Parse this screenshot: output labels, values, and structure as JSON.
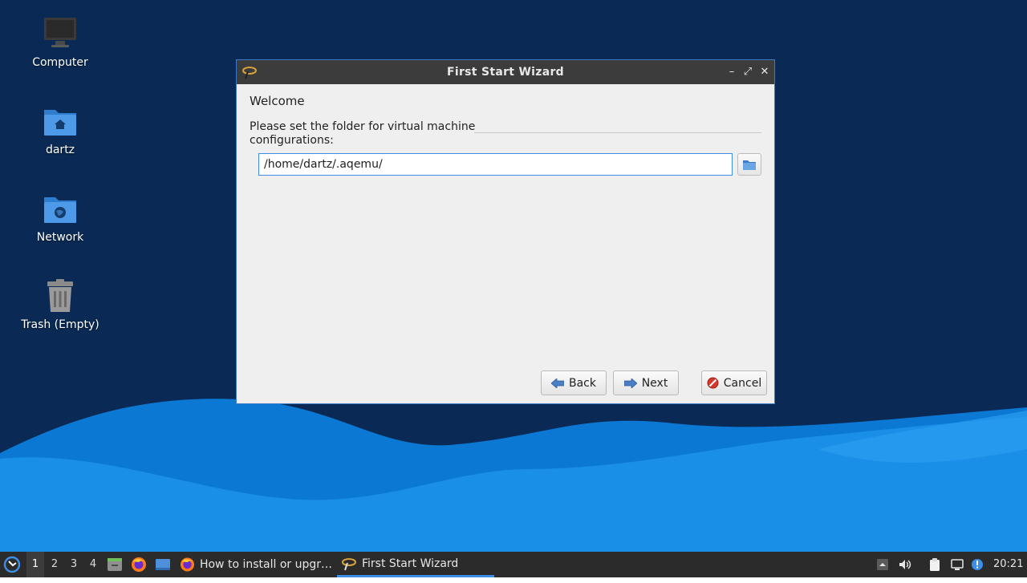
{
  "desktop": {
    "icons": [
      {
        "label": "Computer",
        "icon": "computer-icon"
      },
      {
        "label": "dartz",
        "icon": "home-folder-icon"
      },
      {
        "label": "Network",
        "icon": "network-folder-icon"
      },
      {
        "label": "Trash (Empty)",
        "icon": "trash-icon"
      }
    ]
  },
  "window": {
    "title": "First Start Wizard",
    "heading": "Welcome",
    "prompt": "Please set the folder for virtual machine configurations:",
    "folder_path": "/home/dartz/.aqemu/",
    "buttons": {
      "back": "Back",
      "next": "Next",
      "cancel": "Cancel"
    },
    "controls": {
      "minimize": "–",
      "maximize": "⤢",
      "close": "✕"
    }
  },
  "taskbar": {
    "workspaces": [
      "1",
      "2",
      "3",
      "4"
    ],
    "active_workspace": "1",
    "tasks": [
      {
        "label": "How to install or upgr…",
        "icon": "firefox-icon"
      },
      {
        "label": "First Start Wizard",
        "icon": "aqemu-icon",
        "active": true
      }
    ],
    "clock": "20:21"
  },
  "colors": {
    "desktop_bg": "#0a2a55",
    "accent": "#3d8ee6",
    "titlebar": "#3c3c3c",
    "taskbar": "#2b2b2b"
  }
}
